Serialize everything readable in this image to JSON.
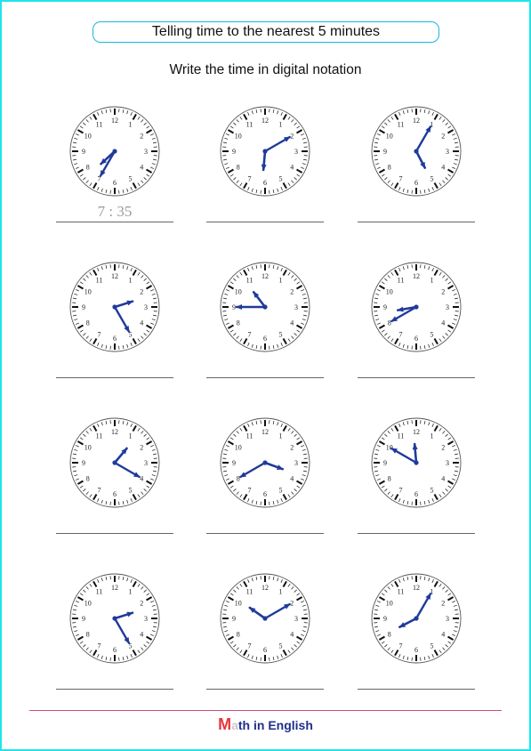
{
  "header": {
    "title": "Telling time to the nearest 5 minutes",
    "instruction": "Write the time in digital notation"
  },
  "colors": {
    "page_border": "#22e4e8",
    "title_border": "#1ab6e0",
    "hands": "#1f3a9a",
    "footer_line": "#d44a7a",
    "logo_m": "#e8343c",
    "logo_text": "#1f2f8a"
  },
  "clock_numbers": [
    "12",
    "1",
    "2",
    "3",
    "4",
    "5",
    "6",
    "7",
    "8",
    "9",
    "10",
    "11"
  ],
  "clocks": [
    {
      "hour": 7,
      "minute": 35,
      "answer": "7 : 35"
    },
    {
      "hour": 6,
      "minute": 10,
      "answer": ""
    },
    {
      "hour": 5,
      "minute": 5,
      "answer": ""
    },
    {
      "hour": 2,
      "minute": 25,
      "answer": ""
    },
    {
      "hour": 10,
      "minute": 45,
      "answer": ""
    },
    {
      "hour": 8,
      "minute": 40,
      "answer": ""
    },
    {
      "hour": 1,
      "minute": 20,
      "answer": ""
    },
    {
      "hour": 3,
      "minute": 40,
      "answer": ""
    },
    {
      "hour": 11,
      "minute": 50,
      "answer": ""
    },
    {
      "hour": 2,
      "minute": 25,
      "answer": ""
    },
    {
      "hour": 10,
      "minute": 10,
      "answer": ""
    },
    {
      "hour": 8,
      "minute": 5,
      "answer": ""
    }
  ],
  "footer": {
    "logo_m": "M",
    "logo_a": "a",
    "logo_rest": "th in English"
  }
}
